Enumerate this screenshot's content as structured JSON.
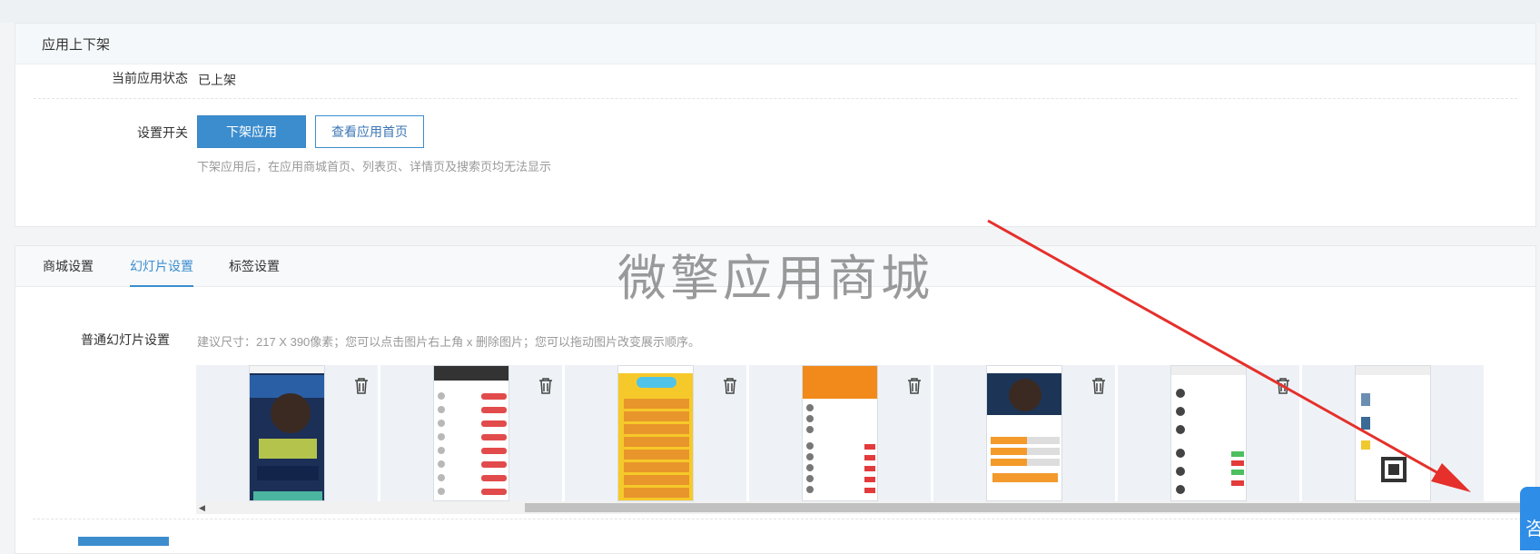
{
  "panel_status": {
    "title": "应用上下架",
    "status_label": "当前应用状态",
    "status_value": "已上架",
    "switch_label": "设置开关",
    "unpublish_button": "下架应用",
    "view_home_button": "查看应用首页",
    "hint": "下架应用后，在应用商城首页、列表页、详情页及搜索页均无法显示"
  },
  "tabs": [
    {
      "label": "商城设置",
      "active": false
    },
    {
      "label": "幻灯片设置",
      "active": true
    },
    {
      "label": "标签设置",
      "active": false
    }
  ],
  "watermark": "微擎应用商城",
  "slides_section": {
    "label": "普通幻灯片设置",
    "hint": "建议尺寸：217 X 390像素；您可以点击图片右上角 x 删除图片；您可以拖动图片改变展示顺序。"
  },
  "slides": [
    {
      "name": "slide-1",
      "theme": "poster-dark"
    },
    {
      "name": "slide-2",
      "theme": "list-red"
    },
    {
      "name": "slide-3",
      "theme": "yellow-rank"
    },
    {
      "name": "slide-4",
      "theme": "orange-list"
    },
    {
      "name": "slide-5",
      "theme": "poster-orange"
    },
    {
      "name": "slide-6",
      "theme": "list-green"
    },
    {
      "name": "slide-7",
      "theme": "qrcode"
    }
  ],
  "consult_button": "咨",
  "colors": {
    "accent": "#3c8dce",
    "arrow": "#e5302b",
    "consult": "#2e8de6"
  }
}
